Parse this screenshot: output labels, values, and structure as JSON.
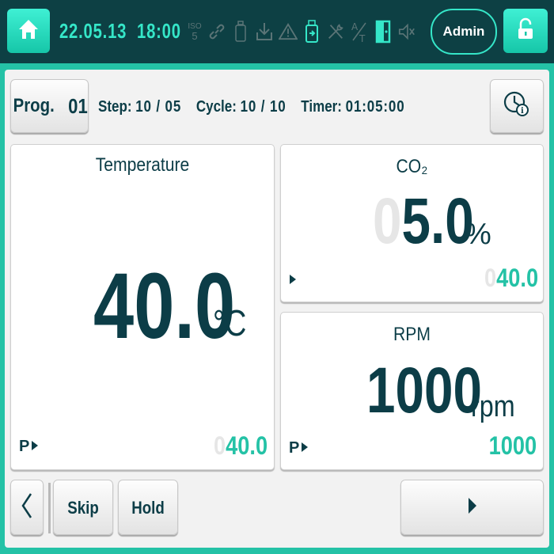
{
  "header": {
    "date": "22.05.13",
    "time": "18:00",
    "iso_label": "ISO",
    "iso_class": "5",
    "admin_label": "Admin",
    "status_icons": [
      "link-icon",
      "bottle-icon",
      "download-icon",
      "warning-icon",
      "usb-icon",
      "tools-icon",
      "a-over-t-icon",
      "door-icon",
      "mute-icon"
    ],
    "icon_off_color": "#5a7476",
    "icon_on_color": "#35e6c8"
  },
  "program": {
    "label": "Prog.",
    "number": "01",
    "step_label": "Step:",
    "step_value": "10 / 05",
    "cycle_label": "Cycle:",
    "cycle_value": "10 / 10",
    "timer_label": "Timer:",
    "timer_value": "01:05:00"
  },
  "temperature": {
    "title": "Temperature",
    "value": "40.0",
    "unit": "°C",
    "p_label": "P",
    "setpoint_ghost": "0",
    "setpoint": "40.0"
  },
  "co2": {
    "title": "CO₂",
    "value_ghost": "0",
    "value": "5.0",
    "unit": "%",
    "setpoint_ghost": "0",
    "setpoint": "40.0"
  },
  "rpm": {
    "title": "RPM",
    "value": "1000",
    "unit": "rpm",
    "p_label": "P",
    "setpoint": "1000"
  },
  "footer": {
    "skip_label": "Skip",
    "hold_label": "Hold"
  },
  "colors": {
    "accent": "#24c2a6",
    "dark_text": "#0c3d47",
    "topbar": "#0d4044"
  }
}
